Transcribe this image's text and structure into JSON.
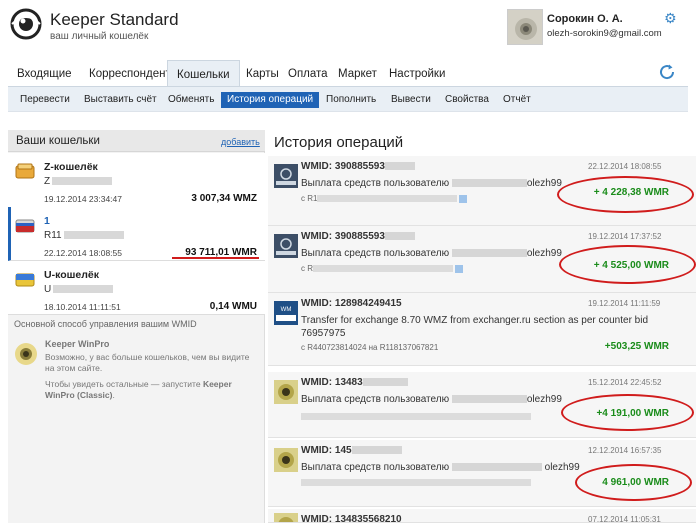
{
  "app": {
    "title": "Keeper Standard",
    "subtitle": "ваш личный кошелёк",
    "logo_icon": "eye-logo-icon"
  },
  "user": {
    "name": "Сорокин О. А.",
    "email": "olezh-sorokin9@gmail.com",
    "settings_icon": "gear-icon"
  },
  "main_tabs": [
    {
      "label": "Входящие"
    },
    {
      "label": "Корреспонденты"
    },
    {
      "label": "Кошельки",
      "active": true
    },
    {
      "label": "Карты"
    },
    {
      "label": "Оплата"
    },
    {
      "label": "Маркет"
    },
    {
      "label": "Настройки"
    }
  ],
  "sub_nav": [
    {
      "label": "Перевести"
    },
    {
      "label": "Выставить счёт"
    },
    {
      "label": "Обменять"
    },
    {
      "label": "История операций",
      "active": true
    },
    {
      "label": "Пополнить"
    },
    {
      "label": "Вывести"
    },
    {
      "label": "Свойства"
    },
    {
      "label": "Отчёт"
    }
  ],
  "wallets_panel": {
    "title": "Ваши кошельки",
    "add_link": "добавить",
    "wallets": [
      {
        "name": "Z-кошелёк",
        "id": "Z",
        "date": "19.12.2014 23:34:47",
        "amount": "3 007,34 WMZ"
      },
      {
        "name": "1",
        "id": "R11",
        "date": "22.12.2014 18:08:55",
        "amount": "93 711,01 WMR",
        "active": true
      },
      {
        "name": "U-кошелёк",
        "id": "U",
        "date": "18.10.2014 11:11:51",
        "amount": "0,14 WMU"
      }
    ],
    "note_title": "Основной способ управления вашим WMID",
    "winpro_title": "Keeper WinPro",
    "winpro_text1": "Возможно, у вас больше кошельков, чем вы видите на этом сайте.",
    "winpro_text2_prefix": "Чтобы увидеть остальные — запустите ",
    "winpro_text2_bold": "Keeper WinPro (Classic)",
    "winpro_text2_suffix": "."
  },
  "history": {
    "title": "История операций",
    "transactions": [
      {
        "wmid": "WMID: 390885593",
        "date": "22.12.2014 18:08:55",
        "desc_prefix": "Выплата средств пользователю ",
        "desc_suffix": "olezh99",
        "sub": "с R1",
        "amount": "+ 4 228,38 WMR",
        "icon": "wmmt-icon"
      },
      {
        "wmid": "WMID: 390885593",
        "date": "19.12.2014 17:37:52",
        "desc_prefix": "Выплата средств пользователю ",
        "desc_suffix": "olezh99",
        "sub": "с R",
        "amount": "+ 4 525,00 WMR",
        "icon": "wmmt-icon"
      },
      {
        "wmid": "WMID: 128984249415",
        "date": "19.12.2014 11:11:59",
        "desc_full": "Transfer for exchange 8.70 WMZ from exchanger.ru section as per counter bid 76957975",
        "sub": "с R440723814024 на R118137067821",
        "amount": "+503,25 WMR",
        "icon": "webmoney-exchanger-icon"
      },
      {
        "wmid": "WMID: 13483",
        "date": "15.12.2014 22:45:52",
        "desc_prefix": "Выплата средств пользователю ",
        "desc_suffix": "olezh99",
        "sub": "",
        "amount": "+4 191,00 WMR",
        "icon": "eye-avatar-icon"
      },
      {
        "wmid": "WMID: 145",
        "date": "12.12.2014 16:57:35",
        "desc_prefix": "Выплата средств пользователю ",
        "desc_suffix": "olezh99",
        "sub": "",
        "amount": "4 961,00 WMR",
        "icon": "eye-avatar-icon"
      },
      {
        "wmid": "WMID: 134835568210",
        "date": "07.12.2014 11:05:31",
        "icon": "eye-avatar-icon"
      }
    ]
  }
}
